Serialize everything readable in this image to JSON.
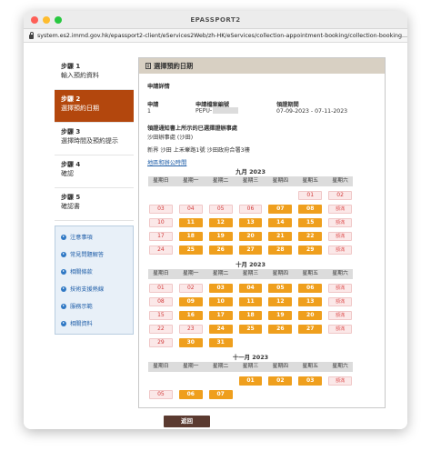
{
  "window": {
    "title": "EPASSPORT2",
    "url": "system.es2.immd.gov.hk/epassport2-client/eServices2Web/zh-HK/eServices/collection-appointment-booking/collection-booking..."
  },
  "sidebar": {
    "steps": [
      {
        "num": "步驟 1",
        "label": "輸入預約資料"
      },
      {
        "num": "步驟 2",
        "label": "選擇預約日期"
      },
      {
        "num": "步驟 3",
        "label": "選擇時間及預約提示"
      },
      {
        "num": "步驟 4",
        "label": "確認"
      },
      {
        "num": "步驟 5",
        "label": "確認書"
      }
    ],
    "links": [
      "注意事項",
      "常見問題解答",
      "相關條款",
      "技術支援熱線",
      "服務示範",
      "相關資料"
    ]
  },
  "panel": {
    "title": "選擇預約日期",
    "section": "申請詳情",
    "col_headers": [
      "申請",
      "申請檔案編號",
      "領證期間"
    ],
    "col_values": [
      "1",
      "PEPU-",
      "07-09-2023 - 07-11-2023"
    ],
    "office_heading": "領證通知書上所示的已選擇證辦事處",
    "office_name": "沙田辦事處 (沙田)",
    "office_address": "新界 沙田 上禾輋路1號 沙田政府合署3樓",
    "hours_link": "地區和辦公時間"
  },
  "calendar": {
    "dow": [
      "星期日",
      "星期一",
      "星期二",
      "星期三",
      "星期四",
      "星期五",
      "星期六"
    ],
    "full_label": "額滿",
    "months": [
      {
        "title": "九月 2023",
        "weeks": [
          [
            [
              "",
              ""
            ],
            [
              "",
              ""
            ],
            [
              "",
              ""
            ],
            [
              "",
              ""
            ],
            [
              "",
              ""
            ],
            [
              "01",
              "u"
            ],
            [
              "02",
              "u"
            ]
          ],
          [
            [
              "03",
              "u"
            ],
            [
              "04",
              "u"
            ],
            [
              "05",
              "u"
            ],
            [
              "06",
              "u"
            ],
            [
              "07",
              "a"
            ],
            [
              "08",
              "a"
            ],
            [
              "09",
              "f"
            ]
          ],
          [
            [
              "10",
              "u"
            ],
            [
              "11",
              "a"
            ],
            [
              "12",
              "a"
            ],
            [
              "13",
              "a"
            ],
            [
              "14",
              "a"
            ],
            [
              "15",
              "a"
            ],
            [
              "16",
              "f"
            ]
          ],
          [
            [
              "17",
              "u"
            ],
            [
              "18",
              "a"
            ],
            [
              "19",
              "a"
            ],
            [
              "20",
              "a"
            ],
            [
              "21",
              "a"
            ],
            [
              "22",
              "a"
            ],
            [
              "23",
              "f"
            ]
          ],
          [
            [
              "24",
              "u"
            ],
            [
              "25",
              "a"
            ],
            [
              "26",
              "a"
            ],
            [
              "27",
              "a"
            ],
            [
              "28",
              "a"
            ],
            [
              "29",
              "a"
            ],
            [
              "30",
              "f"
            ]
          ]
        ]
      },
      {
        "title": "十月 2023",
        "weeks": [
          [
            [
              "01",
              "u"
            ],
            [
              "02",
              "u"
            ],
            [
              "03",
              "a"
            ],
            [
              "04",
              "a"
            ],
            [
              "05",
              "a"
            ],
            [
              "06",
              "a"
            ],
            [
              "07",
              "f"
            ]
          ],
          [
            [
              "08",
              "u"
            ],
            [
              "09",
              "a"
            ],
            [
              "10",
              "a"
            ],
            [
              "11",
              "a"
            ],
            [
              "12",
              "a"
            ],
            [
              "13",
              "a"
            ],
            [
              "14",
              "f"
            ]
          ],
          [
            [
              "15",
              "u"
            ],
            [
              "16",
              "a"
            ],
            [
              "17",
              "a"
            ],
            [
              "18",
              "a"
            ],
            [
              "19",
              "a"
            ],
            [
              "20",
              "a"
            ],
            [
              "21",
              "f"
            ]
          ],
          [
            [
              "22",
              "u"
            ],
            [
              "23",
              "u"
            ],
            [
              "24",
              "a"
            ],
            [
              "25",
              "a"
            ],
            [
              "26",
              "a"
            ],
            [
              "27",
              "a"
            ],
            [
              "28",
              "f"
            ]
          ],
          [
            [
              "29",
              "u"
            ],
            [
              "30",
              "a"
            ],
            [
              "31",
              "a"
            ],
            [
              "",
              ""
            ],
            [
              "",
              ""
            ],
            [
              "",
              ""
            ],
            [
              "",
              ""
            ]
          ]
        ]
      },
      {
        "title": "十一月 2023",
        "weeks": [
          [
            [
              "",
              ""
            ],
            [
              "",
              ""
            ],
            [
              "",
              ""
            ],
            [
              "01",
              "a"
            ],
            [
              "02",
              "a"
            ],
            [
              "03",
              "a"
            ],
            [
              "04",
              "f"
            ]
          ],
          [
            [
              "05",
              "u"
            ],
            [
              "06",
              "a"
            ],
            [
              "07",
              "a"
            ],
            [
              "",
              ""
            ],
            [
              "",
              ""
            ],
            [
              "",
              ""
            ],
            [
              "",
              ""
            ]
          ]
        ]
      }
    ]
  },
  "footer": {
    "back_label": "返回"
  },
  "colors": {
    "accent": "#b3470d",
    "available": "#ef9f1d",
    "unavailable": "#fbe8e8",
    "button": "#5b3a30"
  }
}
